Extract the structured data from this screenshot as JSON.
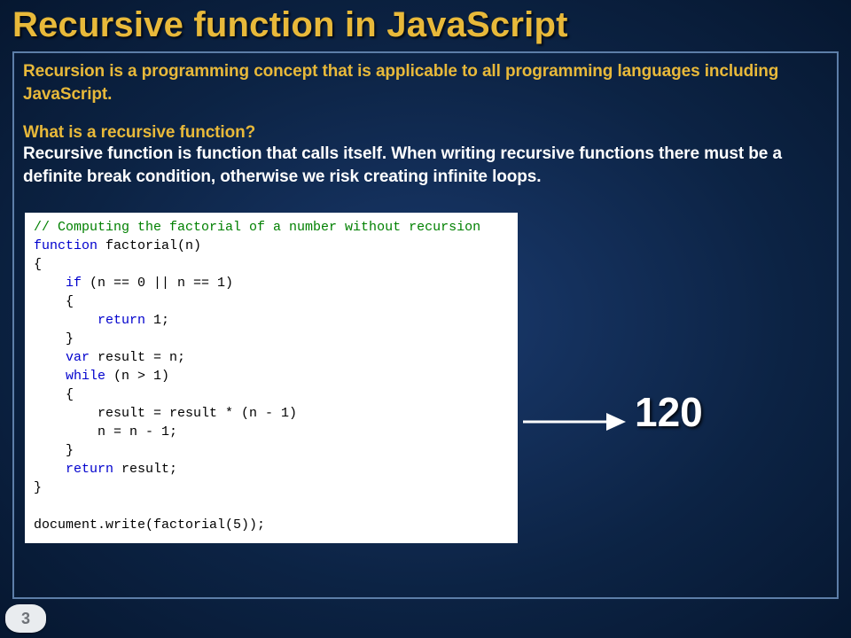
{
  "slide": {
    "title": "Recursive function in JavaScript",
    "intro": "Recursion is a programming concept that is applicable to all programming languages including JavaScript.",
    "question": "What is a recursive function?",
    "body": "Recursive function is function that calls itself. When writing recursive functions there must be a definite break condition, otherwise we risk creating infinite loops.",
    "page_number": "3"
  },
  "code": {
    "comment": "// Computing the factorial of a number without recursion",
    "l2a": "function",
    "l2b": " factorial(n)",
    "l3": "{",
    "l4a": "    if",
    "l4b": " (n == 0 || n == 1)",
    "l5": "    {",
    "l6a": "        return",
    "l6b": " 1;",
    "l7": "    }",
    "l8a": "    var",
    "l8b": " result = n;",
    "l9a": "    while",
    "l9b": " (n > 1)",
    "l10": "    {",
    "l11": "        result = result * (n - 1)",
    "l12": "        n = n - 1;",
    "l13": "    }",
    "l14a": "    return",
    "l14b": " result;",
    "l15": "}",
    "l16": "",
    "l17": "document.write(factorial(5));"
  },
  "output": {
    "value": "120"
  }
}
